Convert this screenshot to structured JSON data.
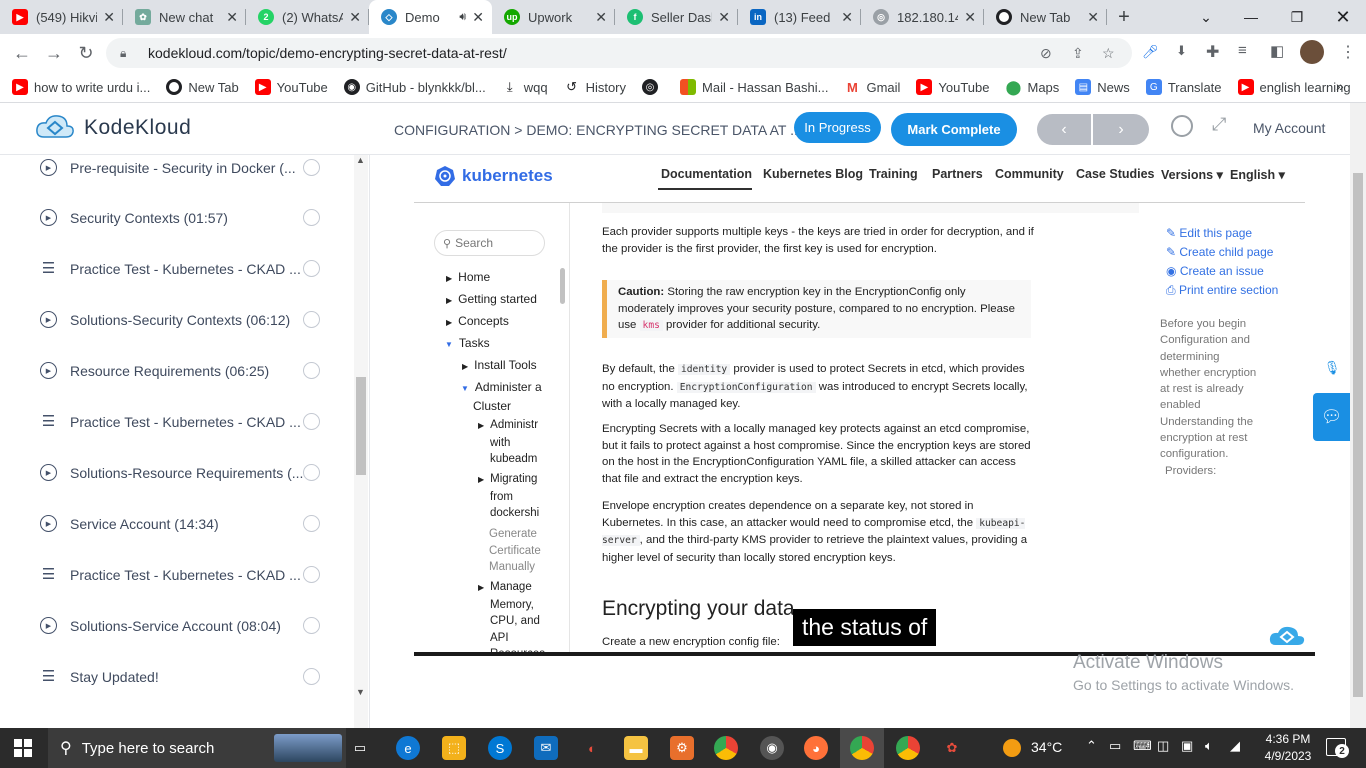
{
  "browser": {
    "tabs": [
      {
        "title": "(549) Hikvi",
        "icon": "youtube-icon",
        "color": "#ff0000"
      },
      {
        "title": "New chat",
        "icon": "openai-icon",
        "color": "#74aa9c"
      },
      {
        "title": "(2) WhatsA",
        "icon": "whatsapp-icon",
        "color": "#25d366"
      },
      {
        "title": "Demo",
        "icon": "kodekloud-icon",
        "color": "#2a87c9",
        "active": true
      },
      {
        "title": "Upwork",
        "icon": "upwork-icon",
        "color": "#14a800"
      },
      {
        "title": "Seller Dash",
        "icon": "fiverr-icon",
        "color": "#1dbf73"
      },
      {
        "title": "(13) Feed |",
        "icon": "linkedin-icon",
        "color": "#0a66c2"
      },
      {
        "title": "182.180.14",
        "icon": "globe-icon",
        "color": "#9aa0a6"
      },
      {
        "title": "New Tab",
        "icon": "chrome-icon",
        "color": "#202124"
      }
    ],
    "url": "kodekloud.com/topic/demo-encrypting-secret-data-at-rest/",
    "bookmarks": [
      {
        "label": "how to write urdu i...",
        "icon": "youtube-icon"
      },
      {
        "label": "New Tab",
        "icon": "chrome-icon"
      },
      {
        "label": "YouTube",
        "icon": "youtube-icon"
      },
      {
        "label": "GitHub - blynkkk/bl...",
        "icon": "github-icon"
      },
      {
        "label": "wqq",
        "icon": "download-icon"
      },
      {
        "label": "History",
        "icon": "history-icon"
      },
      {
        "label": "",
        "icon": "globe-icon"
      },
      {
        "label": "Mail - Hassan Bashi...",
        "icon": "microsoft-icon"
      },
      {
        "label": "Gmail",
        "icon": "gmail-icon"
      },
      {
        "label": "YouTube",
        "icon": "youtube-icon"
      },
      {
        "label": "Maps",
        "icon": "maps-icon"
      },
      {
        "label": "News",
        "icon": "news-icon"
      },
      {
        "label": "Translate",
        "icon": "translate-icon"
      },
      {
        "label": "english learning",
        "icon": "youtube-icon"
      }
    ]
  },
  "header": {
    "brand": "KodeKloud",
    "breadcrumb": "CONFIGURATION > DEMO: ENCRYPTING SECRET DATA AT ...",
    "status_button": "In Progress",
    "complete_button": "Mark Complete",
    "account": "My Account"
  },
  "sidebar": {
    "lessons": [
      {
        "title": "Pre-requisite - Security in Docker (...",
        "type": "video"
      },
      {
        "title": "Security Contexts (01:57)",
        "type": "video"
      },
      {
        "title": "Practice Test - Kubernetes - CKAD ...",
        "type": "quiz"
      },
      {
        "title": "Solutions-Security Contexts (06:12)",
        "type": "video"
      },
      {
        "title": "Resource Requirements (06:25)",
        "type": "video"
      },
      {
        "title": "Practice Test - Kubernetes - CKAD ...",
        "type": "quiz"
      },
      {
        "title": "Solutions-Resource Requirements (...",
        "type": "video"
      },
      {
        "title": "Service Account (14:34)",
        "type": "video"
      },
      {
        "title": "Practice Test - Kubernetes - CKAD ...",
        "type": "quiz"
      },
      {
        "title": "Solutions-Service Account (08:04)",
        "type": "video"
      },
      {
        "title": "Stay Updated!",
        "type": "quiz"
      }
    ]
  },
  "k8s": {
    "brand": "kubernetes",
    "nav": [
      "Documentation",
      "Kubernetes Blog",
      "Training",
      "Partners",
      "Community",
      "Case Studies",
      "Versions ▾",
      "English ▾"
    ],
    "search_placeholder": "Search",
    "tree": {
      "home": "Home",
      "getting_started": "Getting started",
      "concepts": "Concepts",
      "tasks": "Tasks",
      "install_tools": "Install Tools",
      "administer_1": "Administer a",
      "administer_2": "Cluster",
      "sub1": [
        "Administr",
        "with",
        "kubeadm"
      ],
      "sub2": [
        "Migrating",
        "from",
        "dockershi"
      ],
      "sub3": [
        "Generate",
        "Certificate",
        "Manually"
      ],
      "sub4": [
        "Manage",
        "Memory,",
        "CPU, and",
        "API",
        "Resources"
      ]
    },
    "para1": "Each provider supports multiple keys - the keys are tried in order for decryption, and if the provider is the first provider, the first key is used for encryption.",
    "caution_label": "Caution:",
    "caution_a": "Storing the raw encryption key in the EncryptionConfig only moderately improves your security posture, compared to no encryption. Please use",
    "caution_code": "kms",
    "caution_b": "provider for additional security.",
    "para3_a": "By default, the",
    "para3_code1": "identity",
    "para3_b": "provider is used to protect Secrets in etcd, which provides no encryption.",
    "para3_code2": "EncryptionConfiguration",
    "para3_c": "was introduced to encrypt Secrets locally, with a locally managed key.",
    "para4": "Encrypting Secrets with a locally managed key protects against an etcd compromise, but it fails to protect against a host compromise. Since the encryption keys are stored on the host in the EncryptionConfiguration YAML file, a skilled attacker can access that file and extract the encryption keys.",
    "para5_a": "Envelope encryption creates dependence on a separate key, not stored in Kubernetes. In this case, an attacker would need to compromise etcd, the",
    "para5_code": "kubeapi-server",
    "para5_b": ", and the third-party KMS provider to retrieve the plaintext values, providing a higher level of security than locally stored encryption keys.",
    "heading": "Encrypting your data",
    "para6": "Create a new encryption config file:",
    "side_links": [
      "Edit this page",
      "Create child page",
      "Create an issue",
      "Print entire section"
    ],
    "toc": [
      "Before you begin",
      "Configuration and determining whether encryption at rest is already enabled",
      "Understanding the encryption at rest configuration.",
      "Providers:"
    ]
  },
  "caption": "the status of",
  "watermark": {
    "title": "Activate Windows",
    "subtitle": "Go to Settings to activate Windows."
  },
  "taskbar": {
    "search_placeholder": "Type here to search",
    "weather": "34°C",
    "time": "4:36 PM",
    "date": "4/9/2023",
    "notifications": "2"
  }
}
